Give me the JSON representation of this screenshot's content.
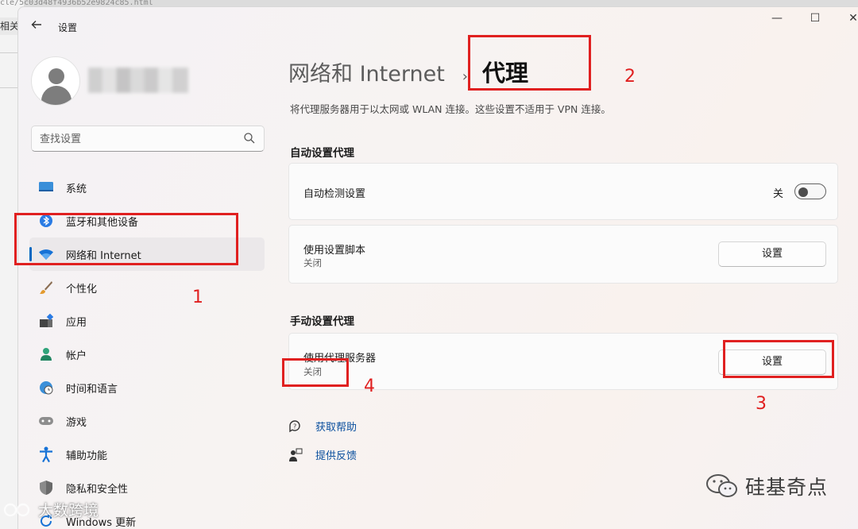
{
  "background": {
    "url_fragment": "cle/5c03d48f4936b52e9824c85.html",
    "tab_label": "相关"
  },
  "window": {
    "app_title": "设置",
    "controls": {
      "minimize": "—",
      "maximize": "☐",
      "close": "✕"
    }
  },
  "profile": {
    "avatar_icon": "user-avatar-icon"
  },
  "search": {
    "placeholder": "查找设置"
  },
  "sidebar": {
    "items": [
      {
        "label": "系统",
        "icon": "system-display-icon"
      },
      {
        "label": "蓝牙和其他设备",
        "icon": "bluetooth-icon"
      },
      {
        "label": "网络和 Internet",
        "icon": "wifi-icon",
        "active": true
      },
      {
        "label": "个性化",
        "icon": "paintbrush-icon"
      },
      {
        "label": "应用",
        "icon": "apps-icon"
      },
      {
        "label": "帐户",
        "icon": "account-icon"
      },
      {
        "label": "时间和语言",
        "icon": "globe-clock-icon"
      },
      {
        "label": "游戏",
        "icon": "gamepad-icon"
      },
      {
        "label": "辅助功能",
        "icon": "accessibility-icon"
      },
      {
        "label": "隐私和安全性",
        "icon": "shield-icon"
      },
      {
        "label": "Windows 更新",
        "icon": "update-icon"
      }
    ]
  },
  "main": {
    "breadcrumb_parent": "网络和 Internet",
    "breadcrumb_sep": "›",
    "breadcrumb_current": "代理",
    "description": "将代理服务器用于以太网或 WLAN 连接。这些设置不适用于 VPN 连接。",
    "auto_section": {
      "heading": "自动设置代理",
      "detect": {
        "title": "自动检测设置",
        "state_label": "关",
        "on": false
      },
      "script": {
        "title": "使用设置脚本",
        "subtitle": "关闭",
        "button": "设置"
      }
    },
    "manual_section": {
      "heading": "手动设置代理",
      "proxy": {
        "title": "使用代理服务器",
        "subtitle": "关闭",
        "button": "设置"
      }
    },
    "links": [
      {
        "label": "获取帮助",
        "icon": "help-icon"
      },
      {
        "label": "提供反馈",
        "icon": "feedback-icon"
      }
    ]
  },
  "annotations": {
    "numbers": [
      "1",
      "2",
      "3",
      "4"
    ],
    "color": "#e02020"
  },
  "watermarks": {
    "right": "硅基奇点",
    "left": "大数跨境"
  },
  "colors": {
    "accent": "#0067c0",
    "link": "#0a4f9e"
  }
}
